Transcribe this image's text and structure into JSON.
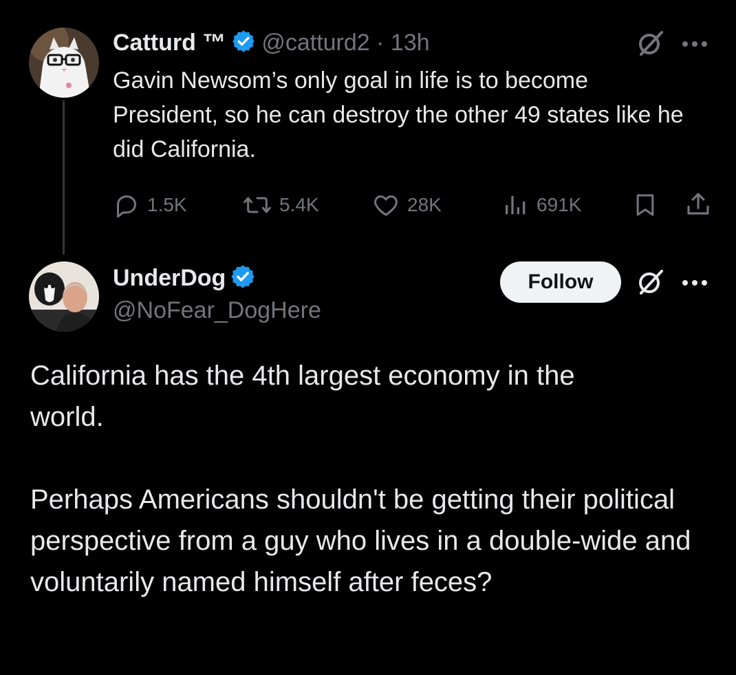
{
  "original_tweet": {
    "name": "Catturd ™",
    "handle_time": "@catturd2 · 13h",
    "text": "Gavin Newsom’s only goal in life is to become President, so he can destroy the other 49 states like he did California.",
    "stats": {
      "replies": "1.5K",
      "retweets": "5.4K",
      "likes": "28K",
      "views": "691K"
    }
  },
  "reply": {
    "name": "UnderDog",
    "handle": "@NoFear_DogHere",
    "follow_label": "Follow",
    "paragraphs": [
      "California has the 4th largest economy in the world.",
      "Perhaps Americans shouldn't be getting their political perspective from a guy who lives in a double-wide and voluntarily named himself after feces?"
    ]
  },
  "colors": {
    "background": "#000000",
    "text_primary": "#e7e9ea",
    "text_secondary": "#71767b",
    "verified": "#1d9bf0",
    "follow_bg": "#eff3f4"
  },
  "icons": [
    "verified-badge-icon",
    "grok-icon",
    "more-icon",
    "reply-icon",
    "retweet-icon",
    "like-icon",
    "views-icon",
    "bookmark-icon",
    "share-icon"
  ]
}
